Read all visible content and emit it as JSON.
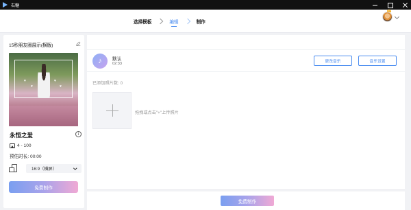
{
  "titlebar": {
    "app_name": "右糖"
  },
  "steps": [
    {
      "label": "选择模板"
    },
    {
      "label": "编辑"
    },
    {
      "label": "制作"
    }
  ],
  "template": {
    "title": "15秒朋友圈展示(横版)",
    "name": "永恒之爱",
    "photo_count": "4 - 100",
    "duration": "预估时长: 00:00",
    "ratio": "16:9（横屏）",
    "make_button": "免费制作"
  },
  "music": {
    "name": "默认",
    "time": "02:33",
    "change_button": "更改音乐",
    "settings_button": "音乐设置"
  },
  "photos": {
    "added_label": "已添加照片数: 0",
    "upload_hint": "拖拽或点击\"+\"上传照片"
  },
  "bottom": {
    "make_button": "免费制作"
  },
  "colors": {
    "accent": "#4a8cf0",
    "gradient_start": "#7a9ff0",
    "gradient_end": "#f0a9d4"
  }
}
